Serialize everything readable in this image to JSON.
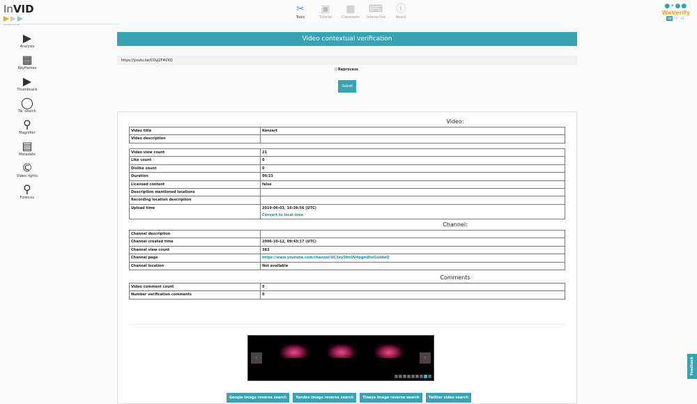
{
  "brand": {
    "logo_text": "InVID",
    "logo_sub": "In video veritas",
    "partner": "WeVerify",
    "langs": [
      "EN",
      "FR",
      "ES"
    ],
    "active_lang": "EN"
  },
  "nav": [
    {
      "label": "Tools",
      "icon": "tools-icon",
      "glyph": "✂"
    },
    {
      "label": "Tutorial",
      "icon": "clapperboard-icon",
      "glyph": "▣"
    },
    {
      "label": "Classroom",
      "icon": "classroom-icon",
      "glyph": "▦"
    },
    {
      "label": "Interactive",
      "icon": "gamepad-icon",
      "glyph": "⌨"
    },
    {
      "label": "About",
      "icon": "info-icon",
      "glyph": "ⓘ"
    }
  ],
  "sidebar": [
    {
      "label": "Analysis",
      "glyph": "▶",
      "icon": "play-icon"
    },
    {
      "label": "Keyframes",
      "glyph": "▦",
      "icon": "film-icon"
    },
    {
      "label": "Thumbnails",
      "glyph": "▶",
      "icon": "youtube-icon"
    },
    {
      "label": "Tw. search",
      "glyph": "◯",
      "icon": "twitter-icon"
    },
    {
      "label": "Magnifier",
      "glyph": "⚲",
      "icon": "magnifier-icon"
    },
    {
      "label": "Metadata",
      "glyph": "▤",
      "icon": "document-icon"
    },
    {
      "label": "Video rights",
      "glyph": "©",
      "icon": "copyright-icon"
    },
    {
      "label": "Forensic",
      "glyph": "⚲",
      "icon": "forensic-icon"
    }
  ],
  "page": {
    "title": "Video contextual verification",
    "url_value": "https://youtu.be/CDyJ2F4VXQ",
    "reprocess_label": "Reprocess",
    "submit_label": "Submit"
  },
  "video": {
    "heading": "Video:",
    "table1": [
      [
        "Video title",
        "Konzert"
      ],
      [
        "Video description",
        ""
      ]
    ],
    "table2": [
      [
        "Video view count",
        "21"
      ],
      [
        "Like count",
        "0"
      ],
      [
        "Dislike count",
        "0"
      ],
      [
        "Duration",
        "00:23"
      ],
      [
        "Licensed content",
        "false"
      ],
      [
        "Description mentioned locations",
        ""
      ],
      [
        "Recording location description",
        ""
      ],
      [
        "Upload time",
        "2019-06-03, 16:39:56 (UTC)"
      ]
    ],
    "convert_link": "Convert to local time"
  },
  "channel": {
    "heading": "Channel:",
    "rows": [
      [
        "Channel description",
        ""
      ],
      [
        "Channel created time",
        "2006-10-12, 09:43:17 (UTC)"
      ],
      [
        "Channel view count",
        "383"
      ],
      [
        "Channel page",
        "https://www.youtube.com/channel/UC3ey50nOV4pgm8IoI1uIdwQ"
      ],
      [
        "Channel location",
        "Not available"
      ]
    ]
  },
  "comments": {
    "heading": "Comments",
    "rows": [
      [
        "Video comment count",
        "0"
      ],
      [
        "Number verification comments",
        "0"
      ]
    ]
  },
  "carousel": {
    "pages": [
      "1",
      "2",
      "3",
      "4",
      "5",
      "6",
      "7",
      "8",
      "9"
    ],
    "active_page": "8"
  },
  "buttons": [
    "Google Image reverse search",
    "Yandex Image reverse search",
    "Tineye Image reverse search",
    "Twitter video search"
  ],
  "feedback": "Feedback",
  "colors": {
    "accent": "#3aa3b3",
    "partner": "#f5a623"
  }
}
